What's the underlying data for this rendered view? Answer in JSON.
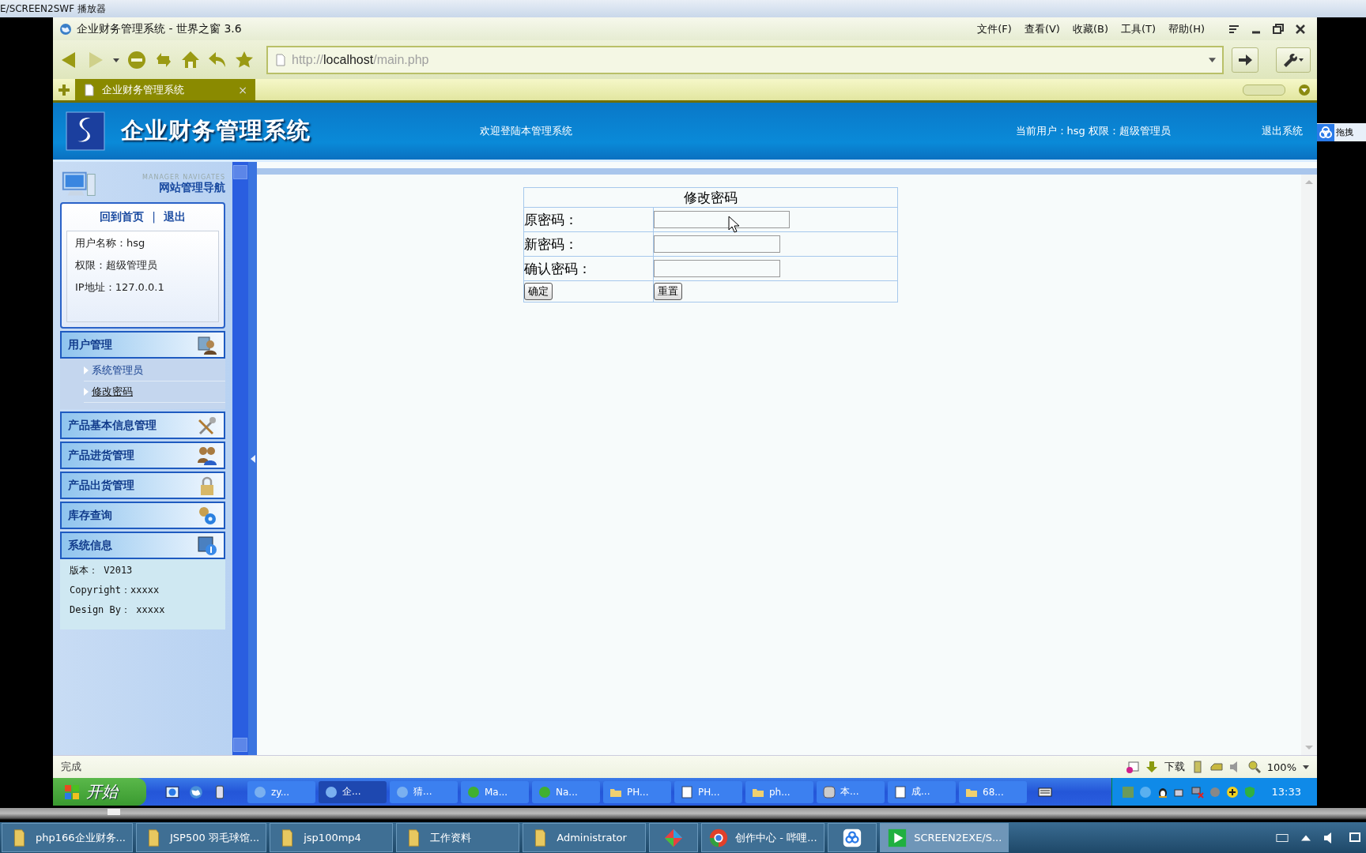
{
  "player_title": "E/SCREEN2SWF 播放器",
  "browser": {
    "title": "企业财务管理系统 - 世界之窗 3.6",
    "menus": [
      "文件(F)",
      "查看(V)",
      "收藏(B)",
      "工具(T)",
      "帮助(H)"
    ],
    "address": {
      "scheme": "http://",
      "host": "localhost",
      "path": "/main.php"
    },
    "tabs": [
      {
        "label": "企业财务管理系统",
        "close": "×",
        "selected": true
      }
    ]
  },
  "header": {
    "title": "企业财务管理系统",
    "welcome": "欢迎登陆本管理系统",
    "current_user": "当前用户：hsg 权限：超级管理员",
    "logout": "退出系统"
  },
  "sidebar": {
    "caption_en": "MANAGER NAVIGATES",
    "caption": "网站管理导航",
    "links": [
      "回到首页",
      "退出"
    ],
    "link_separator": "|",
    "user_info": [
      "用户名称：hsg",
      "权限：超级管理员",
      "IP地址：127.0.0.1"
    ],
    "groups": [
      {
        "title": "用户管理",
        "items": [
          {
            "label": "系统管理员",
            "selected": false
          },
          {
            "label": "修改密码",
            "selected": true
          }
        ]
      },
      {
        "title": "产品基本信息管理"
      },
      {
        "title": "产品进货管理"
      },
      {
        "title": "产品出货管理"
      },
      {
        "title": "库存查询"
      },
      {
        "title": "系统信息",
        "lines": [
          "版本： V2013",
          "Copyright：xxxxx",
          "Design By： xxxxx"
        ]
      }
    ]
  },
  "form": {
    "title": "修改密码",
    "fields": [
      {
        "label": "原密码："
      },
      {
        "label": "新密码："
      },
      {
        "label": "确认密码："
      }
    ],
    "buttons": [
      "确定",
      "重置"
    ]
  },
  "status_bar": {
    "text": "完成",
    "download": "下载",
    "zoom": "100%"
  },
  "xp_taskbar": {
    "start": "开始",
    "buttons": [
      {
        "label": "zy...",
        "selected": false
      },
      {
        "label": "企...",
        "selected": true
      },
      {
        "label": "猜...",
        "selected": false
      },
      {
        "label": "Ma...",
        "selected": false
      },
      {
        "label": "Na...",
        "selected": false
      },
      {
        "label": "PH...",
        "selected": false
      },
      {
        "label": "PH...",
        "selected": false
      },
      {
        "label": "ph...",
        "selected": false
      },
      {
        "label": "本...",
        "selected": false
      },
      {
        "label": "成...",
        "selected": false
      },
      {
        "label": "68...",
        "selected": false
      }
    ],
    "clock": "13:33"
  },
  "side_widget": {
    "label": "拖拽"
  },
  "win7_taskbar": {
    "buttons": [
      {
        "kind": "labeled",
        "label": "php166企业财务...",
        "selected": false
      },
      {
        "kind": "labeled",
        "label": "JSP500 羽毛球馆...",
        "selected": false
      },
      {
        "kind": "labeled",
        "label": "jsp100mp4",
        "selected": false
      },
      {
        "kind": "labeled",
        "label": "工作资料",
        "selected": false
      },
      {
        "kind": "labeled",
        "label": "Administrator",
        "selected": false
      },
      {
        "kind": "pinned",
        "selected": false
      },
      {
        "kind": "labeled",
        "label": "创作中心 - 哔哩...",
        "selected": false
      },
      {
        "kind": "pinned",
        "selected": false
      },
      {
        "kind": "labeled",
        "label": "SCREEN2EXE/S...",
        "selected": true
      }
    ]
  }
}
